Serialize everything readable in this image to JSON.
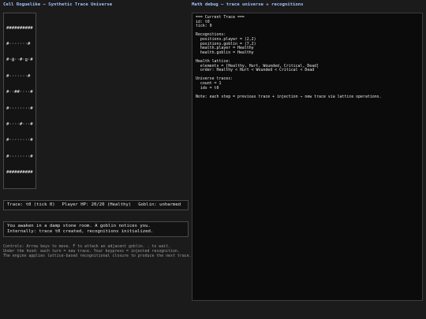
{
  "left": {
    "title": "Cell Roguelike — Synthetic Trace Universe",
    "map_rows": [
      "##########",
      "#·······#",
      "#·@··#·g·#",
      "#·······#",
      "#··##····#",
      "#········#",
      "#····#···#",
      "#········#",
      "#········#",
      "##########"
    ],
    "status": {
      "trace": "Trace: t0 (tick 0)",
      "hp": "Player HP: 20/20 (Healthy)",
      "goblin": "Goblin: unharmed"
    },
    "messages": [
      "You awaken in a damp stone room. A goblin notices you.",
      "Internally: trace t0 created, recognitions initialized."
    ],
    "help": [
      "Controls: Arrow keys to move. F to attack an adjacent goblin. . to wait.",
      "Under the hood: each turn = new trace. Your keypress = injected recognition.",
      "The engine applies lattice-based recognitional closure to produce the next trace."
    ]
  },
  "right": {
    "title": "Math debug — trace universe + recognitions",
    "debug_lines": [
      "=== Current Trace ===",
      "id: t0",
      "tick: 0",
      "",
      "Recognitions:",
      "  positions.player = (2,2)",
      "  positions.goblin = (7,2)",
      "  health.player = Healthy",
      "  health.goblin = Healthy",
      "",
      "Health lattice:",
      "  elements = [Healthy, Hurt, Wounded, Critical, Dead]",
      "  order: Healthy < Hurt < Wounded < Critical < Dead",
      "",
      "Universe traces:",
      "  count = 1",
      "  ids = t0",
      "",
      "Note: each step = previous trace + injection → new trace via lattice operations."
    ]
  }
}
